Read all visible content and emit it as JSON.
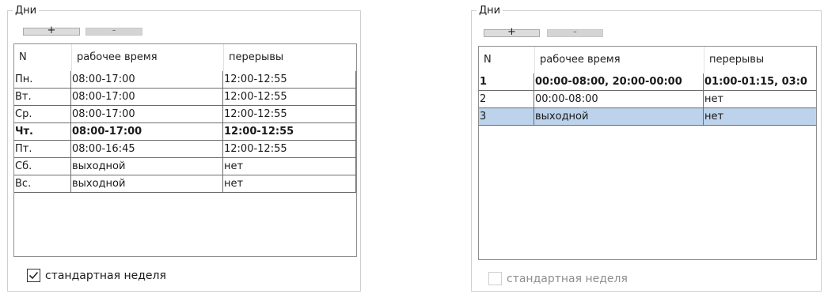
{
  "left_panel": {
    "title": "Дни",
    "add_button": "+",
    "remove_button": "-",
    "columns": [
      "N",
      "рабочее время",
      "перерывы"
    ],
    "rows": [
      {
        "n": "Пн.",
        "work": "08:00-17:00",
        "breaks": "12:00-12:55",
        "bold": false
      },
      {
        "n": "Вт.",
        "work": "08:00-17:00",
        "breaks": "12:00-12:55",
        "bold": false
      },
      {
        "n": "Ср.",
        "work": "08:00-17:00",
        "breaks": "12:00-12:55",
        "bold": false
      },
      {
        "n": "Чт.",
        "work": "08:00-17:00",
        "breaks": "12:00-12:55",
        "bold": true
      },
      {
        "n": "Пт.",
        "work": "08:00-16:45",
        "breaks": "12:00-12:55",
        "bold": false
      },
      {
        "n": "Сб.",
        "work": "выходной",
        "breaks": "нет",
        "bold": false
      },
      {
        "n": "Вс.",
        "work": "выходной",
        "breaks": "нет",
        "bold": false
      }
    ],
    "standard_week": {
      "label": "стандартная неделя",
      "checked": true,
      "disabled": false
    }
  },
  "right_panel": {
    "title": "Дни",
    "add_button": "+",
    "remove_button": "-",
    "columns": [
      "N",
      "рабочее время",
      "перерывы"
    ],
    "rows": [
      {
        "n": "1",
        "work": "00:00-08:00, 20:00-00:00",
        "breaks": "01:00-01:15, 03:0",
        "bold": true,
        "selected": false
      },
      {
        "n": "2",
        "work": "00:00-08:00",
        "breaks": "нет",
        "bold": false,
        "selected": false
      },
      {
        "n": "3",
        "work": "выходной",
        "breaks": "нет",
        "bold": false,
        "selected": true
      }
    ],
    "standard_week": {
      "label": "стандартная неделя",
      "checked": false,
      "disabled": true
    }
  },
  "colors": {
    "selection": "#bdd3eb",
    "group_border": "#cfcfcf",
    "grid_line": "#6d6d6d"
  }
}
